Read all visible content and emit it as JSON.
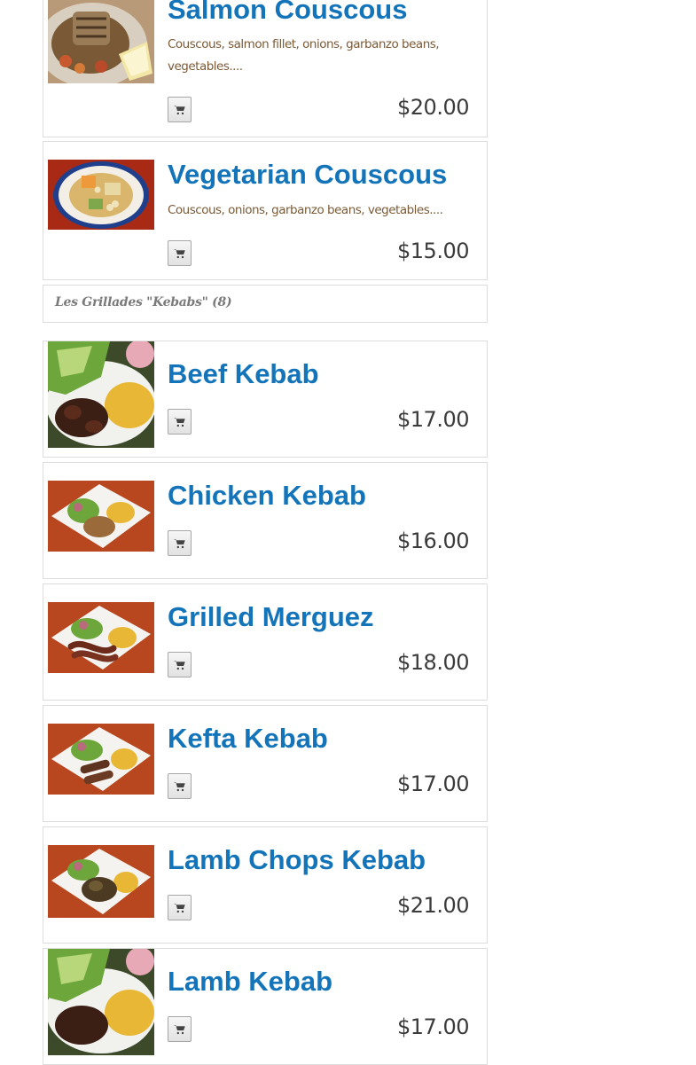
{
  "menu": {
    "couscous_items": [
      {
        "name": "Salmon Couscous",
        "description": "Couscous, salmon fillet, onions, garbanzo beans, vegetables....",
        "price": "$20.00",
        "image": "salmon-couscous-photo"
      },
      {
        "name": "Vegetarian Couscous",
        "description": "Couscous, onions, garbanzo beans, vegetables....",
        "price": "$15.00",
        "image": "vegetarian-couscous-photo"
      }
    ],
    "kebab_category": {
      "label": "Les Grillades \"Kebabs\" (8)"
    },
    "kebab_items": [
      {
        "name": "Beef Kebab",
        "price": "$17.00",
        "image": "beef-kebab-photo"
      },
      {
        "name": "Chicken Kebab",
        "price": "$16.00",
        "image": "chicken-kebab-photo"
      },
      {
        "name": "Grilled Merguez",
        "price": "$18.00",
        "image": "grilled-merguez-photo"
      },
      {
        "name": "Kefta Kebab",
        "price": "$17.00",
        "image": "kefta-kebab-photo"
      },
      {
        "name": "Lamb Chops Kebab",
        "price": "$21.00",
        "image": "lamb-chops-kebab-photo"
      },
      {
        "name": "Lamb Kebab",
        "price": "$17.00",
        "image": "lamb-kebab-photo"
      }
    ],
    "cart_icon": "shopping-cart-icon"
  },
  "colors": {
    "title": "#1474b9",
    "description": "#7b5a36",
    "price": "#3b3b3b",
    "border": "#dddddd"
  }
}
